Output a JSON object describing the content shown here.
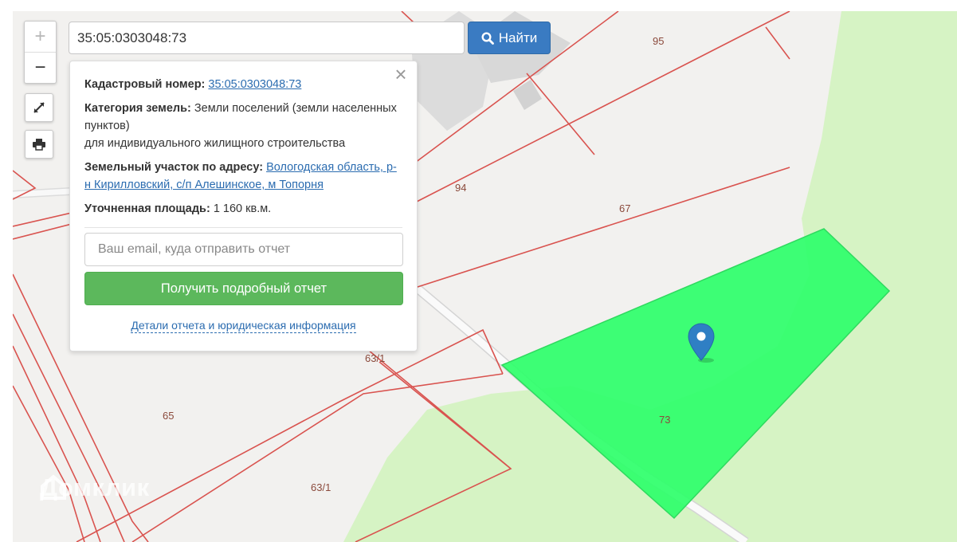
{
  "search": {
    "value": "35:05:0303048:73",
    "button_label": "Найти"
  },
  "zoom": {
    "in_label": "+",
    "out_label": "−"
  },
  "popup": {
    "cadastral_label": "Кадастровый номер:",
    "cadastral_value": "35:05:0303048:73",
    "category_label": "Категория земель:",
    "category_value": "Земли поселений (земли населенных пунктов)",
    "category_usage": "для индивидуального жилищного строительства",
    "address_label": "Земельный участок по адресу:",
    "address_value": "Вологодская область, р-н Кирилловский, с/п Алешинское, м Топорня",
    "area_label": "Уточненная площадь:",
    "area_value": "1 160 кв.м.",
    "email_placeholder": "Ваш email, куда отправить отчет",
    "report_button": "Получить подробный отчет",
    "details_link": "Детали отчета и юридическая информация",
    "close_icon": "close-icon"
  },
  "map": {
    "plot_labels": [
      "95",
      "94",
      "67",
      "63/1",
      "65",
      "63/1",
      "73"
    ],
    "watermark": "Домклик",
    "colors": {
      "boundary": "#d9534f",
      "selected_plot": "#2eff6a",
      "forest": "#d4f2c0",
      "marker": "#2f7fc4"
    },
    "icons": [
      "plus-icon",
      "minus-icon",
      "fullscreen-icon",
      "print-icon",
      "search-icon",
      "map-marker-icon"
    ]
  }
}
